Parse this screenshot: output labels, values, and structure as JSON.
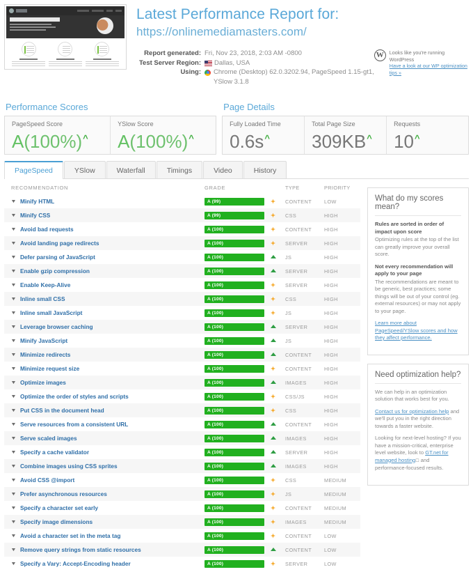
{
  "header": {
    "title": "Latest Performance Report for:",
    "url": "https://onlinemediamasters.com/",
    "meta": [
      {
        "label": "Report generated:",
        "value": "Fri, Nov 23, 2018, 2:03 AM -0800",
        "icon": "none"
      },
      {
        "label": "Test Server Region:",
        "value": "Dallas, USA",
        "icon": "us-flag-icon"
      },
      {
        "label": "Using:",
        "value": "Chrome (Desktop) 62.0.3202.94, PageSpeed 1.15-gt1,",
        "icon": "chrome-icon"
      },
      {
        "label": "",
        "value": "YSlow 3.1.8",
        "icon": "none"
      }
    ],
    "wordpress_notice": {
      "logo": "W",
      "line1": "Looks like you're running WordPress",
      "link": "Have a look at our WP optimization tips »"
    },
    "thumbnail": {
      "site_title": "WordPress SEO Tutorials",
      "alt": "website-screenshot-thumbnail"
    }
  },
  "summary": {
    "scores": {
      "heading": "Performance Scores",
      "cells": [
        {
          "label": "PageSpeed Score",
          "grade": "A",
          "value": "(100%)",
          "trend": "up"
        },
        {
          "label": "YSlow Score",
          "grade": "A",
          "value": "(100%)",
          "trend": "up"
        }
      ]
    },
    "details": {
      "heading": "Page Details",
      "cells": [
        {
          "label": "Fully Loaded Time",
          "value": "0.6s",
          "trend": "up"
        },
        {
          "label": "Total Page Size",
          "value": "309KB",
          "trend": "up"
        },
        {
          "label": "Requests",
          "value": "10",
          "trend": "up"
        }
      ]
    }
  },
  "tabs": [
    {
      "label": "PageSpeed",
      "active": true
    },
    {
      "label": "YSlow",
      "active": false
    },
    {
      "label": "Waterfall",
      "active": false
    },
    {
      "label": "Timings",
      "active": false
    },
    {
      "label": "Video",
      "active": false
    },
    {
      "label": "History",
      "active": false
    }
  ],
  "table": {
    "columns": [
      "RECOMMENDATION",
      "GRADE",
      "TYPE",
      "PRIORITY"
    ],
    "rows": [
      {
        "name": "Minify HTML",
        "grade": "A (99)",
        "score": 99,
        "trend": "flat",
        "type": "CONTENT",
        "priority": "LOW"
      },
      {
        "name": "Minify CSS",
        "grade": "A (99)",
        "score": 99,
        "trend": "flat",
        "type": "CSS",
        "priority": "HIGH"
      },
      {
        "name": "Avoid bad requests",
        "grade": "A (100)",
        "score": 100,
        "trend": "flat",
        "type": "CONTENT",
        "priority": "HIGH"
      },
      {
        "name": "Avoid landing page redirects",
        "grade": "A (100)",
        "score": 100,
        "trend": "flat",
        "type": "SERVER",
        "priority": "HIGH"
      },
      {
        "name": "Defer parsing of JavaScript",
        "grade": "A (100)",
        "score": 100,
        "trend": "up",
        "type": "JS",
        "priority": "HIGH"
      },
      {
        "name": "Enable gzip compression",
        "grade": "A (100)",
        "score": 100,
        "trend": "up",
        "type": "SERVER",
        "priority": "HIGH"
      },
      {
        "name": "Enable Keep-Alive",
        "grade": "A (100)",
        "score": 100,
        "trend": "flat",
        "type": "SERVER",
        "priority": "HIGH"
      },
      {
        "name": "Inline small CSS",
        "grade": "A (100)",
        "score": 100,
        "trend": "flat",
        "type": "CSS",
        "priority": "HIGH"
      },
      {
        "name": "Inline small JavaScript",
        "grade": "A (100)",
        "score": 100,
        "trend": "flat",
        "type": "JS",
        "priority": "HIGH"
      },
      {
        "name": "Leverage browser caching",
        "grade": "A (100)",
        "score": 100,
        "trend": "up",
        "type": "SERVER",
        "priority": "HIGH"
      },
      {
        "name": "Minify JavaScript",
        "grade": "A (100)",
        "score": 100,
        "trend": "up",
        "type": "JS",
        "priority": "HIGH"
      },
      {
        "name": "Minimize redirects",
        "grade": "A (100)",
        "score": 100,
        "trend": "up",
        "type": "CONTENT",
        "priority": "HIGH"
      },
      {
        "name": "Minimize request size",
        "grade": "A (100)",
        "score": 100,
        "trend": "flat",
        "type": "CONTENT",
        "priority": "HIGH"
      },
      {
        "name": "Optimize images",
        "grade": "A (100)",
        "score": 100,
        "trend": "up",
        "type": "IMAGES",
        "priority": "HIGH"
      },
      {
        "name": "Optimize the order of styles and scripts",
        "grade": "A (100)",
        "score": 100,
        "trend": "flat",
        "type": "CSS/JS",
        "priority": "HIGH"
      },
      {
        "name": "Put CSS in the document head",
        "grade": "A (100)",
        "score": 100,
        "trend": "flat",
        "type": "CSS",
        "priority": "HIGH"
      },
      {
        "name": "Serve resources from a consistent URL",
        "grade": "A (100)",
        "score": 100,
        "trend": "up",
        "type": "CONTENT",
        "priority": "HIGH"
      },
      {
        "name": "Serve scaled images",
        "grade": "A (100)",
        "score": 100,
        "trend": "up",
        "type": "IMAGES",
        "priority": "HIGH"
      },
      {
        "name": "Specify a cache validator",
        "grade": "A (100)",
        "score": 100,
        "trend": "up",
        "type": "SERVER",
        "priority": "HIGH"
      },
      {
        "name": "Combine images using CSS sprites",
        "grade": "A (100)",
        "score": 100,
        "trend": "up",
        "type": "IMAGES",
        "priority": "HIGH"
      },
      {
        "name": "Avoid CSS @import",
        "grade": "A (100)",
        "score": 100,
        "trend": "flat",
        "type": "CSS",
        "priority": "MEDIUM"
      },
      {
        "name": "Prefer asynchronous resources",
        "grade": "A (100)",
        "score": 100,
        "trend": "flat",
        "type": "JS",
        "priority": "MEDIUM"
      },
      {
        "name": "Specify a character set early",
        "grade": "A (100)",
        "score": 100,
        "trend": "flat",
        "type": "CONTENT",
        "priority": "MEDIUM"
      },
      {
        "name": "Specify image dimensions",
        "grade": "A (100)",
        "score": 100,
        "trend": "flat",
        "type": "IMAGES",
        "priority": "MEDIUM"
      },
      {
        "name": "Avoid a character set in the meta tag",
        "grade": "A (100)",
        "score": 100,
        "trend": "flat",
        "type": "CONTENT",
        "priority": "LOW"
      },
      {
        "name": "Remove query strings from static resources",
        "grade": "A (100)",
        "score": 100,
        "trend": "up",
        "type": "CONTENT",
        "priority": "LOW"
      },
      {
        "name": "Specify a Vary: Accept-Encoding header",
        "grade": "A (100)",
        "score": 100,
        "trend": "flat",
        "type": "SERVER",
        "priority": "LOW"
      }
    ]
  },
  "sidebar": {
    "scores_card": {
      "title": "What do my scores mean?",
      "b1": "Rules are sorted in order of impact upon score",
      "p1": "Optimizing rules at the top of the list can greatly improve your overall score.",
      "b2": "Not every recommendation will apply to your page",
      "p2": "The recommendations are meant to be generic, best practices; some things will be out of your control (eg. external resources) or may not apply to your page.",
      "link": "Learn more about PageSpeed/YSlow scores and how they affect performance."
    },
    "help_card": {
      "title": "Need optimization help?",
      "p1": "We can help in an optimization solution that works best for you.",
      "link1": "Contact us for optimization help",
      "p2": " and we'll put you in the right direction towards a faster website.",
      "b1": "Looking for next-level hosting?",
      "p3": " If you have a mission-critical, enterprise level website, look to ",
      "link2": "GT.net for managed hosting",
      "p4": " and performance-focused results."
    }
  },
  "colors": {
    "accent_blue": "#5aa8d8",
    "grade_green": "#21b01f",
    "trend_flat": "#f5a623",
    "trend_up": "#2f9e44",
    "link": "#4a90c4"
  }
}
